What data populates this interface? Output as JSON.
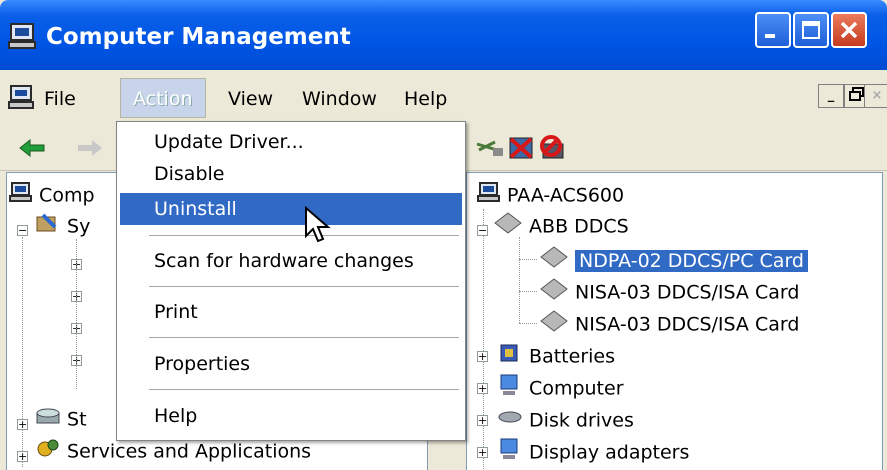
{
  "window": {
    "title": "Computer Management",
    "accent": "#0054e3"
  },
  "menubar": {
    "items": [
      "File",
      "Action",
      "View",
      "Window",
      "Help"
    ]
  },
  "action_menu": {
    "items": [
      "Update Driver...",
      "Disable",
      "Uninstall",
      "Scan for hardware changes",
      "Print",
      "Properties",
      "Help"
    ],
    "highlighted": "Uninstall"
  },
  "left_tree": {
    "root": "Computer Management (Local)",
    "visible_root": "Comp",
    "system_tools_partial": "Sy",
    "storage_partial": "St",
    "services": "Services and Applications"
  },
  "right_tree": {
    "computer": "PAA-ACS600",
    "category": "ABB DDCS",
    "devices": [
      "NDPA-02 DDCS/PC Card",
      "NISA-03 DDCS/ISA Card",
      "NISA-03 DDCS/ISA Card"
    ],
    "selected": "NDPA-02 DDCS/PC Card",
    "categories": [
      "Batteries",
      "Computer",
      "Disk drives",
      "Display adapters"
    ]
  },
  "icons": [
    "computer-icon",
    "back-arrow-icon",
    "forward-arrow-icon",
    "scan-hardware-icon",
    "uninstall-icon",
    "disable-icon",
    "diamond-device-icon"
  ]
}
